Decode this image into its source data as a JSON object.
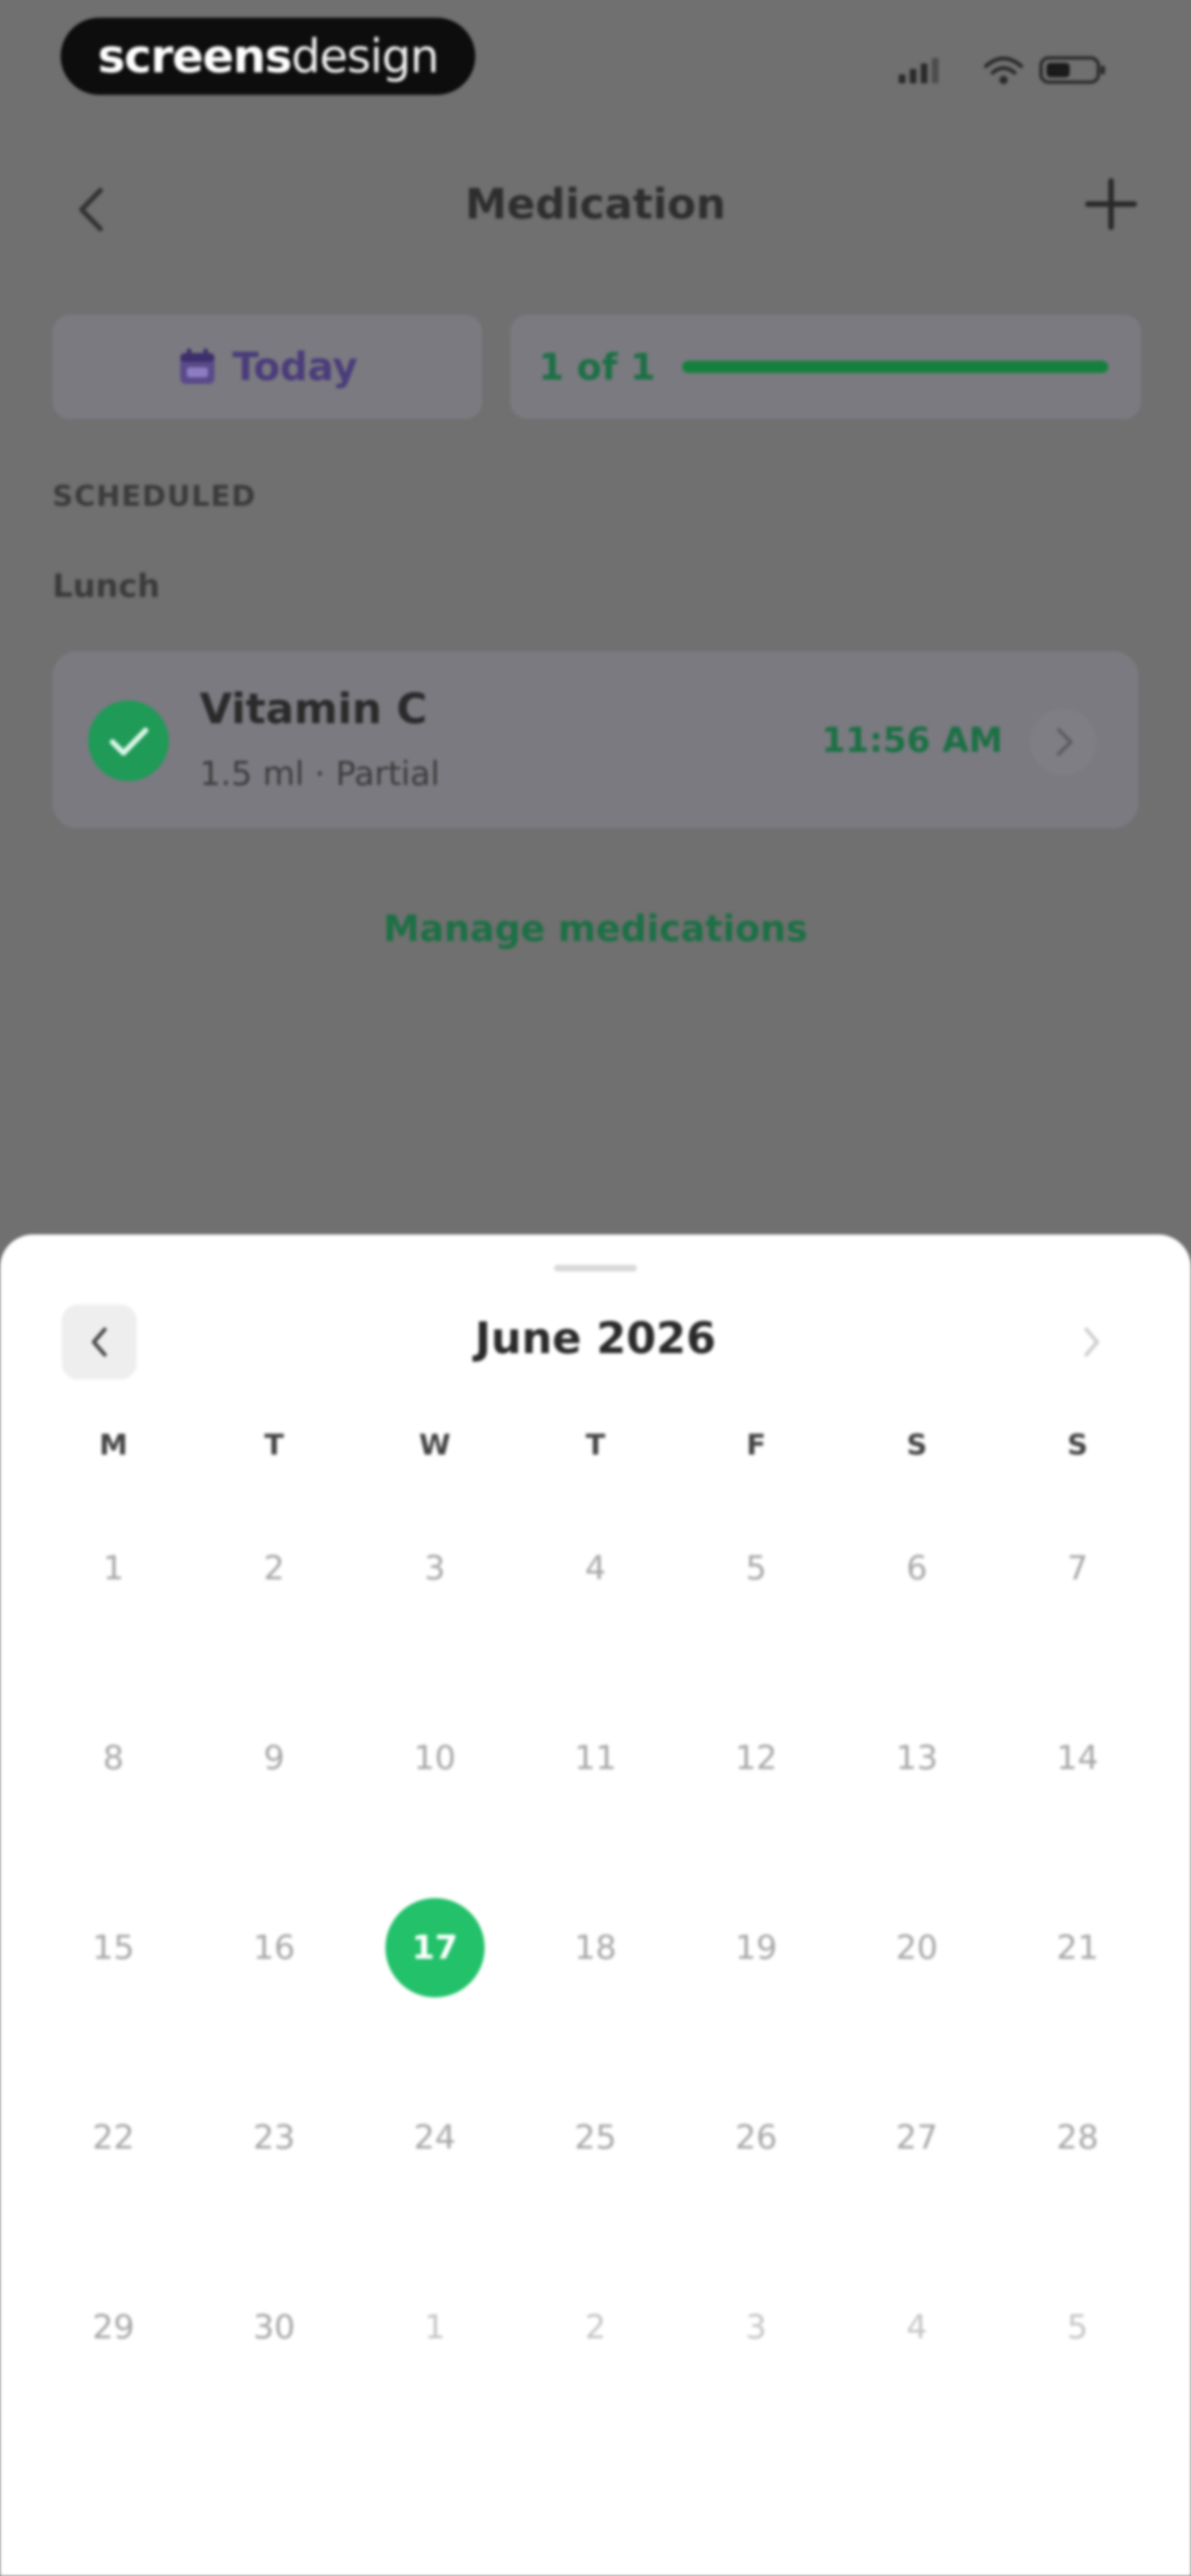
{
  "brand": {
    "bold": "screens",
    "light": "design"
  },
  "header": {
    "title": "Medication"
  },
  "controls": {
    "today_label": "Today",
    "progress_text": "1 of 1",
    "progress_fraction": 1.0
  },
  "schedule": {
    "section_label": "SCHEDULED",
    "group_label": "Lunch",
    "item": {
      "name": "Vitamin C",
      "detail": "1.5 ml · Partial",
      "time": "11:56 AM",
      "status": "taken"
    }
  },
  "manage_link": "Manage medications",
  "calendar": {
    "month_label": "June 2026",
    "weekdays": [
      "M",
      "T",
      "W",
      "T",
      "F",
      "S",
      "S"
    ],
    "weeks": [
      [
        "1",
        "2",
        "3",
        "4",
        "5",
        "6",
        "7"
      ],
      [
        "8",
        "9",
        "10",
        "11",
        "12",
        "13",
        "14"
      ],
      [
        "15",
        "16",
        "17",
        "18",
        "19",
        "20",
        "21"
      ],
      [
        "22",
        "23",
        "24",
        "25",
        "26",
        "27",
        "28"
      ],
      [
        "29",
        "30",
        "1",
        "2",
        "3",
        "4",
        "5"
      ]
    ],
    "selected_day": "17"
  },
  "colors": {
    "accent_green": "#23c16a",
    "dark_green": "#15803d",
    "today_purple": "#4b3c7a"
  },
  "icons": {
    "back": "chevron-left-icon",
    "add": "plus-icon",
    "calendar": "calendar-icon",
    "check": "check-circle-icon",
    "chevron_right": "chevron-right-icon"
  }
}
